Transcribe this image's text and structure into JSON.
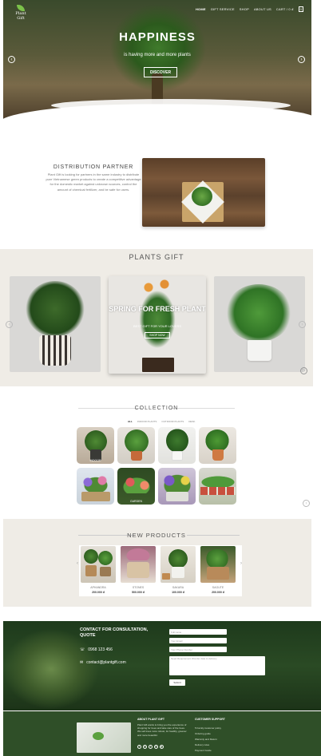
{
  "brand": {
    "logo_text": "Plant Gift"
  },
  "nav": {
    "items": [
      "HOME",
      "GIFT SERVICE",
      "SHOP",
      "ABOUT US"
    ],
    "cart": "CART / 0 đ",
    "cart_count": "0"
  },
  "hero": {
    "title": "HAPPINESS",
    "subtitle": "is having more and more plants",
    "button": "DISCOVER",
    "prev": "‹",
    "next": "›"
  },
  "distribution": {
    "title": "DISTRIBUTION PARTNER",
    "text": "Plant Gift is looking for partners in the same industry to distribute pure Vietnamese green products to create a competitive advantage for the domestic market against unknown sources, control the amount of chemical fertilizer, and be safe for users."
  },
  "plants_gift": {
    "title": "PLANTS GIFT",
    "slide_title": "SPRING FOR FRESH PLANT",
    "slide_sub": "BEST GIFT FOR YOUR LOVERS",
    "slide_button": "SHOP NOW",
    "prev": "‹",
    "next": "›",
    "play": "▷"
  },
  "collection": {
    "title": "COLLECTION",
    "tabs": [
      "ALL",
      "INDOOR PLANTS",
      "OUTDOOR PLANTS",
      "DESK"
    ],
    "tile_labels": [
      "INDOOR",
      "GARDEN"
    ],
    "next": "›"
  },
  "new_products": {
    "title": "NEW PRODUCTS",
    "items": [
      {
        "name": "APHANDRA",
        "price": "200.000 đ"
      },
      {
        "name": "STONES",
        "price": "500.000 đ"
      },
      {
        "name": "SAKARA",
        "price": "100.000 đ"
      },
      {
        "name": "SAGUTE",
        "price": "200.000 đ"
      }
    ],
    "prev": "‹",
    "next": "›"
  },
  "contact": {
    "title": "CONTACT FOR CONSULTATION, QUOTE",
    "phone": "0968 123 456",
    "email": "contact@plantgift.com",
    "placeholders": [
      "Full name",
      "Your Email",
      "Your Phone Number",
      "Need Requirement Wonder data to delivery"
    ],
    "submit": "Submit"
  },
  "footer": {
    "about_title": "ABOUT PLANT GIFT",
    "about_text": "Plant Gift wants to bring you the experience of shopping for trees and take care of the trees. We sell trees more robust, for healthy, greener and more beautiful.",
    "support_title": "CUSTOMER SUPPORT",
    "support_items": [
      "5 Family customer policy",
      "Ordering guide",
      "Warranty and Return",
      "Delivery rules",
      "Payment Guide"
    ],
    "social": [
      "f",
      "G",
      "t",
      "in",
      "▶"
    ]
  },
  "colors": {
    "hero_dark": "#3a4a2c",
    "footer": "#2f4f28",
    "contact_bg": "#1e3a1c",
    "accent_leaf": "#7cc24a"
  }
}
